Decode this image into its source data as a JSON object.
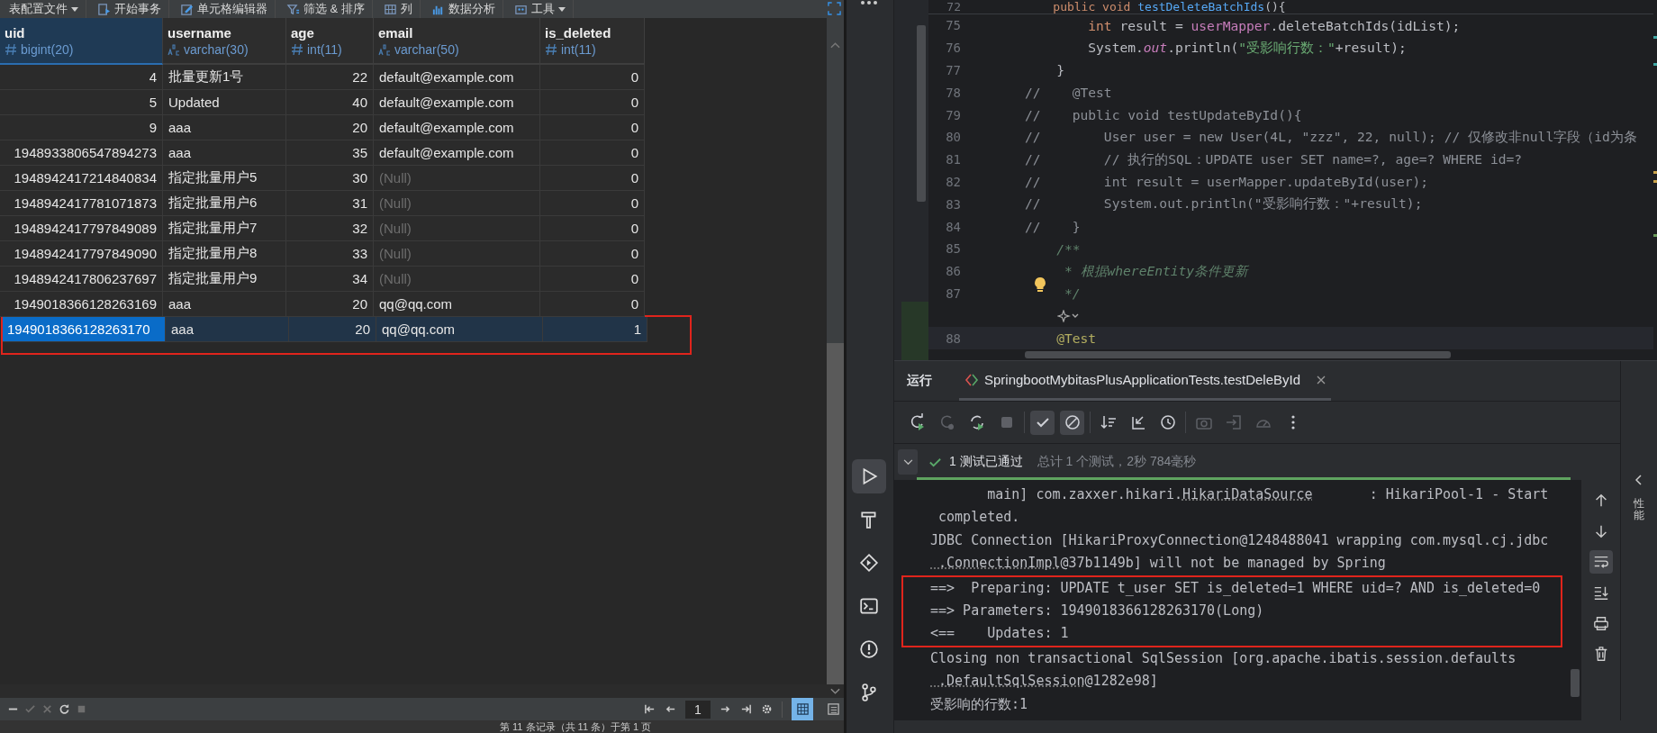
{
  "db_toolbar": [
    {
      "kind": "config",
      "label": "表配置文件",
      "dropdown": true
    },
    {
      "kind": "transaction",
      "label": "开始事务",
      "dropdown": false
    },
    {
      "kind": "edit",
      "label": "单元格编辑器",
      "dropdown": false
    },
    {
      "kind": "filter",
      "label": "筛选 & 排序",
      "dropdown": false
    },
    {
      "kind": "columns",
      "label": "列",
      "dropdown": false
    },
    {
      "kind": "chart",
      "label": "数据分析",
      "dropdown": false
    },
    {
      "kind": "tools",
      "label": "工具",
      "dropdown": true
    }
  ],
  "table": {
    "columns": [
      {
        "name": "uid",
        "type": "bigint(20)",
        "kind": "number",
        "selected": true
      },
      {
        "name": "username",
        "type": "varchar(30)",
        "kind": "text",
        "selected": false
      },
      {
        "name": "age",
        "type": "int(11)",
        "kind": "number",
        "selected": false
      },
      {
        "name": "email",
        "type": "varchar(50)",
        "kind": "text",
        "selected": false
      },
      {
        "name": "is_deleted",
        "type": "int(11)",
        "kind": "number",
        "selected": false
      }
    ],
    "rows": [
      {
        "cells": [
          "4",
          "批量更新1号",
          "22",
          "default@example.com",
          "0"
        ],
        "email_null": false,
        "selected": false,
        "marked": false
      },
      {
        "cells": [
          "5",
          "Updated",
          "40",
          "default@example.com",
          "0"
        ],
        "email_null": false,
        "selected": false,
        "marked": false
      },
      {
        "cells": [
          "9",
          "aaa",
          "20",
          "default@example.com",
          "0"
        ],
        "email_null": false,
        "selected": false,
        "marked": false
      },
      {
        "cells": [
          "1948933806547894273",
          "aaa",
          "35",
          "default@example.com",
          "0"
        ],
        "email_null": false,
        "selected": false,
        "marked": false
      },
      {
        "cells": [
          "1948942417214840834",
          "指定批量用户5",
          "30",
          "(Null)",
          "0"
        ],
        "email_null": true,
        "selected": false,
        "marked": false
      },
      {
        "cells": [
          "1948942417781071873",
          "指定批量用户6",
          "31",
          "(Null)",
          "0"
        ],
        "email_null": true,
        "selected": false,
        "marked": false
      },
      {
        "cells": [
          "1948942417797849089",
          "指定批量用户7",
          "32",
          "(Null)",
          "0"
        ],
        "email_null": true,
        "selected": false,
        "marked": false
      },
      {
        "cells": [
          "1948942417797849090",
          "指定批量用户8",
          "33",
          "(Null)",
          "0"
        ],
        "email_null": true,
        "selected": false,
        "marked": false
      },
      {
        "cells": [
          "1948942417806237697",
          "指定批量用户9",
          "34",
          "(Null)",
          "0"
        ],
        "email_null": true,
        "selected": false,
        "marked": false
      },
      {
        "cells": [
          "1949018366128263169",
          "aaa",
          "20",
          "qq@qq.com",
          "0"
        ],
        "email_null": false,
        "selected": false,
        "marked": false
      },
      {
        "cells": [
          "1949018366128263170",
          "aaa",
          "20",
          "qq@qq.com",
          "1"
        ],
        "email_null": false,
        "selected": true,
        "marked": true
      }
    ]
  },
  "record_tools": [
    {
      "kind": "remove",
      "disabled": false
    },
    {
      "kind": "apply",
      "disabled": true
    },
    {
      "kind": "discard",
      "disabled": true
    },
    {
      "kind": "refresh",
      "disabled": false
    },
    {
      "kind": "stop",
      "disabled": true
    }
  ],
  "pager": {
    "page": "1"
  },
  "view_modes": [
    {
      "kind": "grid",
      "selected": true
    },
    {
      "kind": "form",
      "selected": false
    }
  ],
  "status_text": "第 11 条记录（共 11 条）于第 1 页",
  "editor": {
    "sticky": {
      "number": "72",
      "tokens": [
        {
          "kind": "kw",
          "text": "    public void "
        },
        {
          "kind": "decl",
          "text": "testDeleteBatchIds"
        },
        {
          "kind": "plain",
          "text": "(){"
        }
      ]
    },
    "lines": [
      {
        "kind": "code",
        "number": "75",
        "current": false,
        "bulb": false,
        "tokens": [
          {
            "kind": "kw",
            "text": "        int"
          },
          {
            "kind": "plain",
            "text": " result = "
          },
          {
            "kind": "field",
            "text": "userMapper"
          },
          {
            "kind": "plain",
            "text": ".deleteBatchIds(idList);"
          }
        ]
      },
      {
        "kind": "code",
        "number": "76",
        "current": false,
        "bulb": false,
        "tokens": [
          {
            "kind": "plain",
            "text": "        System."
          },
          {
            "kind": "static",
            "text": "out"
          },
          {
            "kind": "plain",
            "text": ".println("
          },
          {
            "kind": "string",
            "text": "\"受影响行数：\""
          },
          {
            "kind": "plain",
            "text": "+result);"
          }
        ]
      },
      {
        "kind": "code",
        "number": "77",
        "current": false,
        "bulb": false,
        "tokens": [
          {
            "kind": "plain",
            "text": "    }"
          }
        ]
      },
      {
        "kind": "code",
        "number": "78",
        "current": false,
        "bulb": false,
        "tokens": [
          {
            "kind": "comment",
            "text": "//    @Test"
          }
        ]
      },
      {
        "kind": "code",
        "number": "79",
        "current": false,
        "bulb": false,
        "tokens": [
          {
            "kind": "comment",
            "text": "//    public void testUpdateById(){"
          }
        ]
      },
      {
        "kind": "code",
        "number": "80",
        "current": false,
        "bulb": false,
        "tokens": [
          {
            "kind": "comment",
            "text": "//        User user = new User(4L, \"zzz\", 22, null); // 仅修改非null字段（id为条"
          }
        ]
      },
      {
        "kind": "code",
        "number": "81",
        "current": false,
        "bulb": false,
        "tokens": [
          {
            "kind": "comment",
            "text": "//        // 执行的SQL：UPDATE user SET name=?, age=? WHERE id=?"
          }
        ]
      },
      {
        "kind": "code",
        "number": "82",
        "current": false,
        "bulb": false,
        "tokens": [
          {
            "kind": "comment",
            "text": "//        int result = userMapper.updateById(user);"
          }
        ]
      },
      {
        "kind": "code",
        "number": "83",
        "current": false,
        "bulb": false,
        "tokens": [
          {
            "kind": "comment",
            "text": "//        System.out.println(\"受影响行数：\"+result);"
          }
        ]
      },
      {
        "kind": "code",
        "number": "84",
        "current": false,
        "bulb": false,
        "tokens": [
          {
            "kind": "comment",
            "text": "//    }"
          }
        ]
      },
      {
        "kind": "code",
        "number": "85",
        "current": false,
        "bulb": false,
        "tokens": [
          {
            "kind": "doc",
            "text": "    /**"
          }
        ]
      },
      {
        "kind": "code",
        "number": "86",
        "current": false,
        "bulb": false,
        "tokens": [
          {
            "kind": "doc",
            "text": "     * 根据whereEntity条件更新"
          }
        ]
      },
      {
        "kind": "code",
        "number": "87",
        "current": false,
        "bulb": true,
        "tokens": [
          {
            "kind": "doc",
            "text": "     */"
          }
        ]
      },
      {
        "kind": "inlay"
      },
      {
        "kind": "code",
        "number": "88",
        "current": true,
        "bulb": false,
        "tokens": [
          {
            "kind": "annotation",
            "text": "    @Test"
          }
        ]
      }
    ]
  },
  "run": {
    "label": "运行",
    "tabs": [
      {
        "title": "SpringbootMybitasPlusApplicationTests.testDeleById",
        "selected": true
      }
    ],
    "tools": [
      {
        "kind": "rerun",
        "disabled": false,
        "on": false
      },
      {
        "kind": "rerun-failed",
        "disabled": true,
        "on": false
      },
      {
        "kind": "toggle-rerun",
        "disabled": false,
        "on": false
      },
      {
        "kind": "stop",
        "disabled": true,
        "on": false
      },
      {
        "kind": "passed",
        "disabled": false,
        "on": true
      },
      {
        "kind": "ignored",
        "disabled": false,
        "on": true
      },
      {
        "kind": "sort",
        "disabled": false,
        "on": false
      },
      {
        "kind": "collapse",
        "disabled": false,
        "on": false
      },
      {
        "kind": "history",
        "disabled": false,
        "on": false
      },
      {
        "kind": "camera",
        "disabled": true,
        "on": false
      },
      {
        "kind": "import",
        "disabled": true,
        "on": false
      },
      {
        "kind": "gauge",
        "disabled": true,
        "on": false
      },
      {
        "kind": "more",
        "disabled": false,
        "on": false
      }
    ],
    "summary": {
      "passed": "1 测试已通过",
      "detail": "总计 1 个测试，2秒 784毫秒",
      "level": 1
    },
    "console": [
      {
        "marked": false,
        "tokens": [
          {
            "kind": "plain",
            "text": "       main] com.zaxxer.hikari."
          },
          {
            "kind": "link",
            "text": "HikariDataSource"
          },
          {
            "kind": "plain",
            "text": "       : HikariPool-1 - Start"
          }
        ]
      },
      {
        "marked": false,
        "tokens": [
          {
            "kind": "plain",
            "text": " completed."
          }
        ]
      },
      {
        "marked": false,
        "tokens": [
          {
            "kind": "plain",
            "text": "JDBC Connection [HikariProxyConnection@1248488041 wrapping com.mysql.cj.jdbc"
          }
        ]
      },
      {
        "marked": false,
        "tokens": [
          {
            "kind": "link",
            "text": " .ConnectionImpl"
          },
          {
            "kind": "plain",
            "text": "@37b1149b] will not be managed by Spring"
          }
        ]
      },
      {
        "marked": true,
        "tokens": [
          {
            "kind": "plain",
            "text": "==>  Preparing: UPDATE t_user SET is_deleted=1 WHERE uid=? AND is_deleted=0"
          }
        ]
      },
      {
        "marked": true,
        "tokens": [
          {
            "kind": "plain",
            "text": "==> Parameters: 1949018366128263170(Long)"
          }
        ]
      },
      {
        "marked": true,
        "tokens": [
          {
            "kind": "plain",
            "text": "<==    Updates: 1"
          }
        ]
      },
      {
        "marked": false,
        "tokens": [
          {
            "kind": "plain",
            "text": "Closing non transactional SqlSession [org.apache.ibatis.session.defaults"
          }
        ]
      },
      {
        "marked": false,
        "tokens": [
          {
            "kind": "link",
            "text": " .DefaultSqlSession"
          },
          {
            "kind": "plain",
            "text": "@1282e98]"
          }
        ]
      },
      {
        "marked": false,
        "tokens": [
          {
            "kind": "plain",
            "text": "受影响的行数:1"
          }
        ]
      }
    ],
    "console_tools": [
      {
        "kind": "up",
        "on": false
      },
      {
        "kind": "down",
        "on": false
      },
      {
        "kind": "wrap",
        "on": true
      },
      {
        "kind": "scroll-end",
        "on": false
      },
      {
        "kind": "print",
        "on": false
      },
      {
        "kind": "trash",
        "on": false
      }
    ],
    "side_label": "性能"
  }
}
